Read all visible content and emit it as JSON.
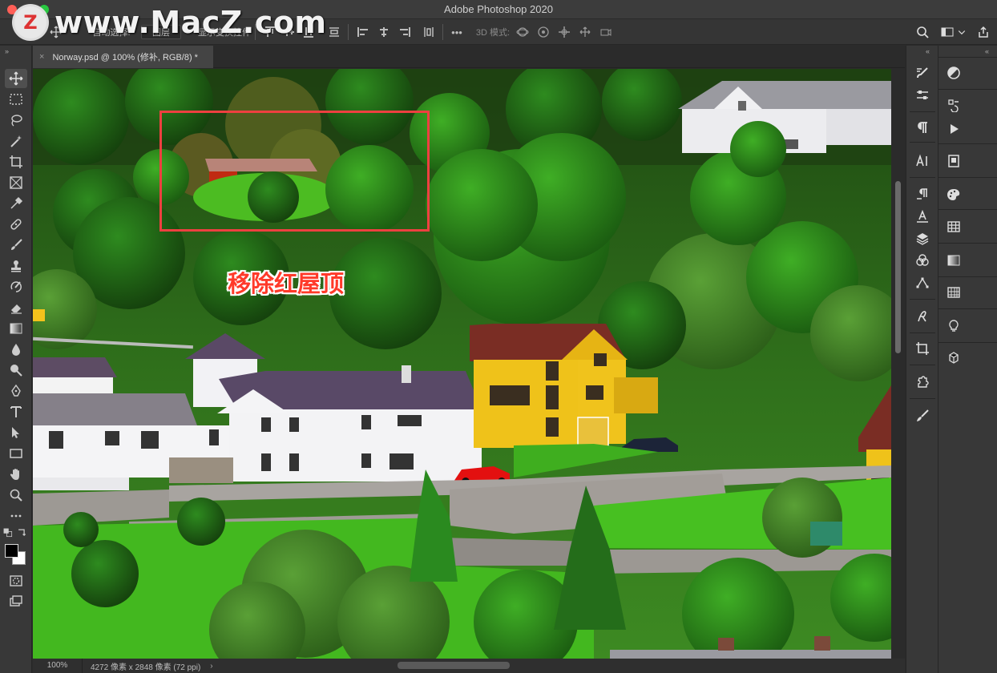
{
  "app": {
    "title": "Adobe Photoshop 2020"
  },
  "watermark": {
    "logo_letter": "Z",
    "text": "www.MacZ.com"
  },
  "options_bar": {
    "auto_select_label": "自动选择:",
    "auto_select_value": "图层",
    "show_transform_label": "显示变换控件",
    "mode_3d_label": "3D 模式:",
    "more_label": "•••"
  },
  "document": {
    "tab_title": "Norway.psd @ 100% (修补, RGB/8) *",
    "tab_close": "×"
  },
  "annotation": {
    "text": "移除红屋顶"
  },
  "status": {
    "zoom": "100%",
    "doc_info": "4272 像素 x 2848 像素 (72 ppi)",
    "arrow": "›"
  },
  "toolbar": {
    "collapse": "»",
    "tools": [
      "move-tool",
      "marquee-tool",
      "lasso-tool",
      "magic-wand-tool",
      "crop-tool",
      "frame-tool",
      "eyedropper-tool",
      "healing-brush-tool",
      "brush-tool",
      "clone-stamp-tool",
      "history-brush-tool",
      "eraser-tool",
      "gradient-tool",
      "blur-tool",
      "dodge-tool",
      "pen-tool",
      "type-tool",
      "path-selection-tool",
      "rectangle-tool",
      "hand-tool",
      "zoom-tool",
      "edit-toolbar"
    ],
    "colors": {
      "foreground": "#000000",
      "background": "#ffffff"
    }
  },
  "panels": {
    "col1_collapse": "«",
    "col2_collapse": "«",
    "col1": [
      "brush-settings-icon",
      "tool-presets-icon",
      "paragraph-icon",
      "character-icon",
      "paragraph-styles-icon",
      "character-styles-icon",
      "layers-icon",
      "channels-icon",
      "paths-icon",
      "glyphs-icon",
      "crop-icon",
      "libraries-icon",
      "brushes-icon"
    ],
    "col2": [
      "adjustments-icon",
      "history-icon",
      "actions-icon",
      "properties-icon",
      "color-icon",
      "swatches-icon",
      "gradients-icon",
      "patterns-icon",
      "learn-icon",
      "3d-icon"
    ]
  },
  "colors": {
    "selection_box": "#ee4040",
    "annotation": "#ff3a2a",
    "ui_bg": "#383838"
  }
}
